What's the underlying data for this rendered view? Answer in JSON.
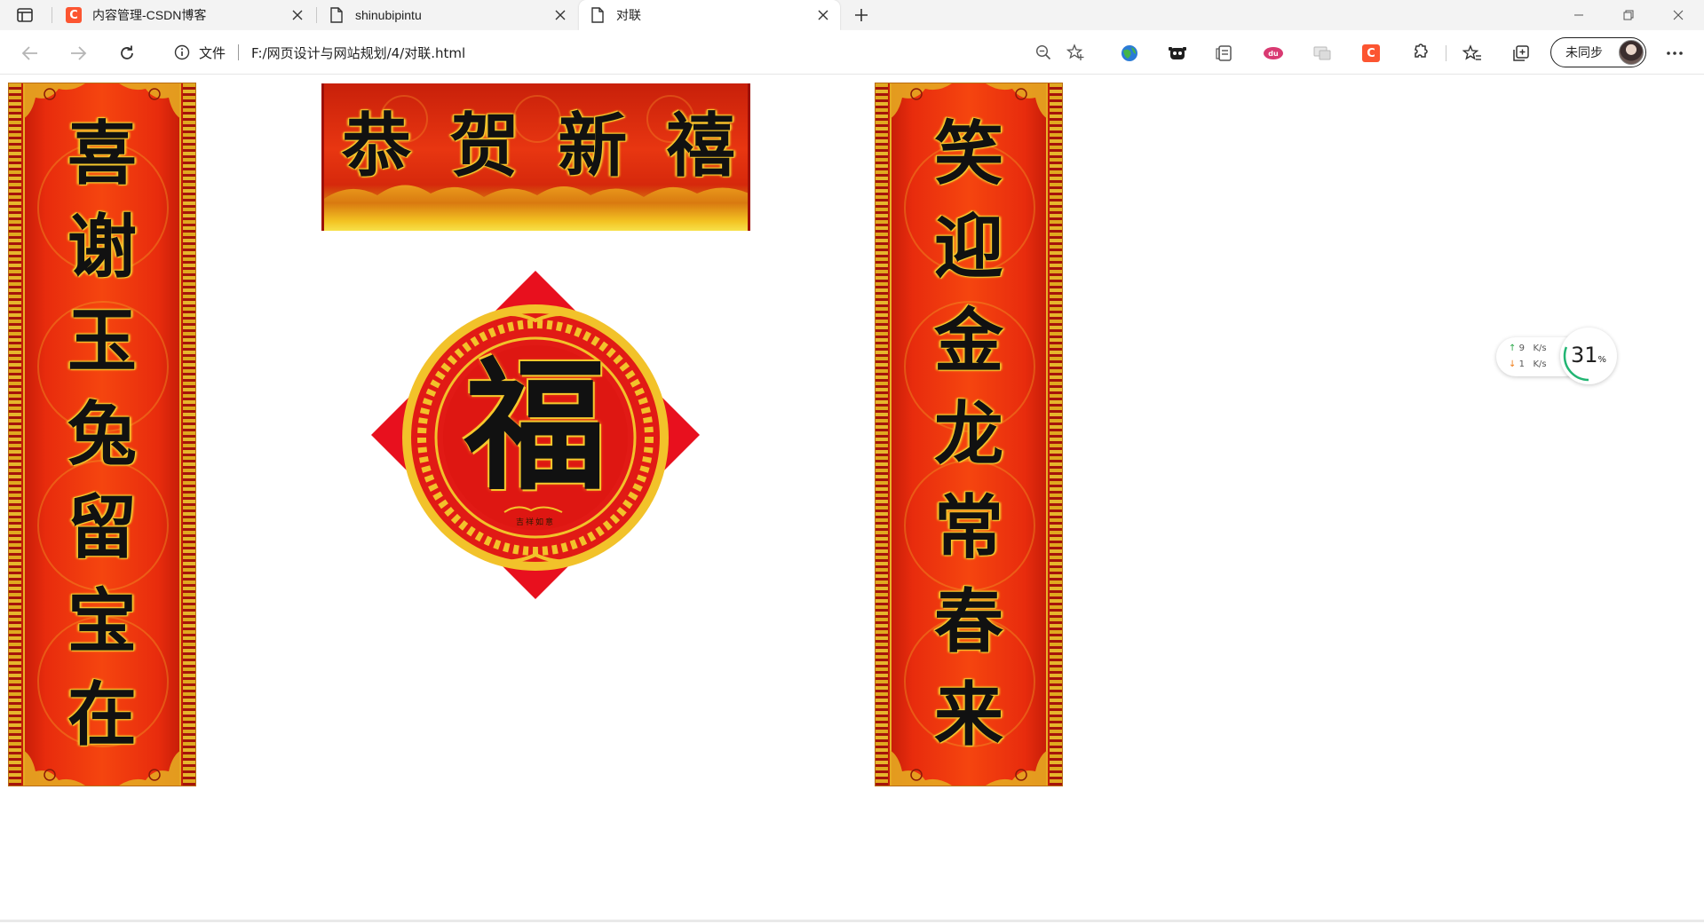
{
  "browser": {
    "tabs": [
      {
        "title": "内容管理-CSDN博客",
        "favicon": "csdn-icon",
        "active": false
      },
      {
        "title": "shinubipintu",
        "favicon": "document-icon",
        "active": false
      },
      {
        "title": "对联",
        "favicon": "document-icon",
        "active": true
      }
    ],
    "address": {
      "security_label": "文件",
      "url": "F:/网页设计与网站规划/4/对联.html"
    },
    "profile": {
      "label": "未同步"
    },
    "icons": [
      "sidebar-icon",
      "close-icon",
      "new-tab-icon",
      "minimize-icon",
      "restore-icon",
      "back-icon",
      "forward-icon",
      "refresh-icon",
      "info-icon",
      "zoom-out-icon",
      "add-favorite-icon",
      "extensions-icon",
      "favorites-icon",
      "collections-icon",
      "more-icon"
    ],
    "colors": {
      "tabstrip": "#f3f3f3",
      "csdn_brand": "#fc5531"
    }
  },
  "page": {
    "left_couplet": [
      "喜",
      "谢",
      "玉",
      "兔",
      "留",
      "宝",
      "在"
    ],
    "right_couplet": [
      "笑",
      "迎",
      "金",
      "龙",
      "常",
      "春",
      "来"
    ],
    "banner": [
      "恭",
      "贺",
      "新",
      "禧"
    ],
    "fu": "福",
    "fu_seal": "吉祥如意",
    "colors": {
      "red": "#e82c0d",
      "gold": "#f6c92d",
      "ink": "#111111"
    }
  },
  "netspeed": {
    "upload": "9",
    "download": "1",
    "unit": "K/s",
    "percent": "31",
    "percent_unit": "%",
    "percent_value": 31
  }
}
